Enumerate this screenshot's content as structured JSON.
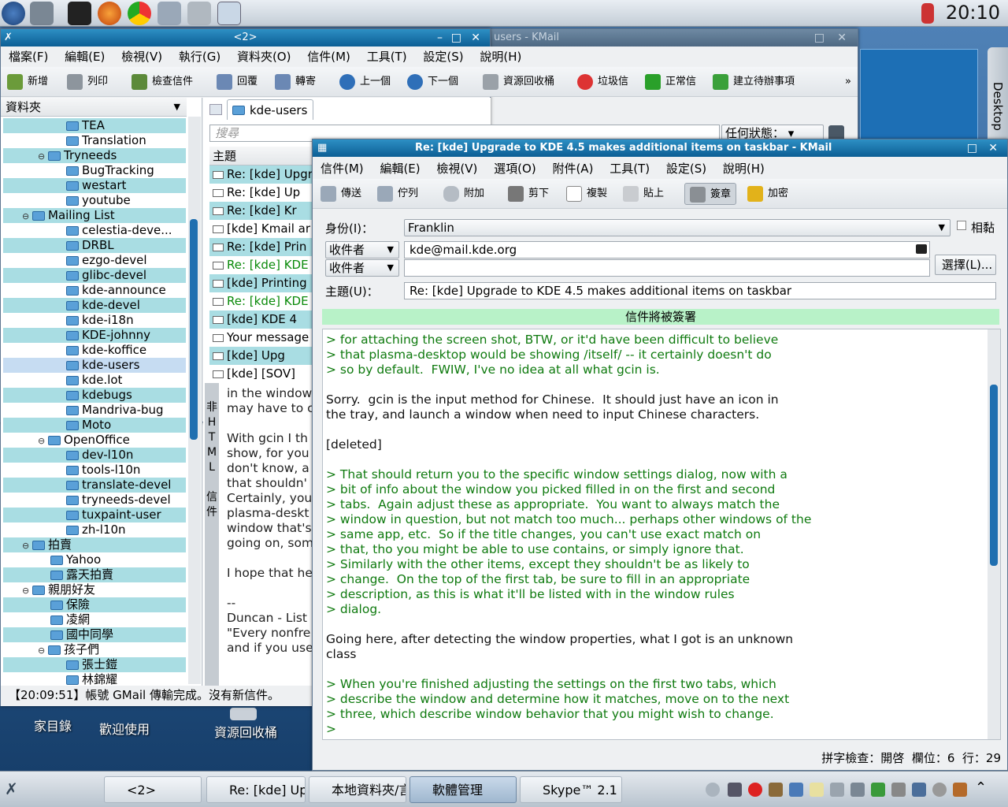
{
  "panel": {
    "clock": "20:10"
  },
  "desktop": {
    "icons": [
      "家目錄",
      "歡迎使用",
      "資源回收桶"
    ],
    "widget_label": "Desktop"
  },
  "kmail": {
    "title": "<2>",
    "bg_title": "users - KMail",
    "menu": [
      "檔案(F)",
      "編輯(E)",
      "檢視(V)",
      "執行(G)",
      "資料夾(O)",
      "信件(M)",
      "工具(T)",
      "設定(S)",
      "說明(H)"
    ],
    "toolbar": [
      "新增",
      "列印",
      "檢查信件",
      "回覆",
      "轉寄",
      "上一個",
      "下一個",
      "資源回收桶",
      "垃圾信",
      "正常信",
      "建立待辦事項"
    ],
    "folder_header": "資料夾",
    "tab": "kde-users",
    "search_placeholder": "搜尋",
    "status_filter": "任何狀態：",
    "list_header": "主題",
    "status": "【20:09:51】帳號 GMail 傳輸完成。沒有新信件。",
    "folders": [
      "TEA",
      "Translation",
      "Tryneeds",
      "BugTracking",
      "westart",
      "youtube",
      "Mailing List",
      "celestia-deve...",
      "DRBL",
      "ezgo-devel",
      "glibc-devel",
      "kde-announce",
      "kde-devel",
      "kde-i18n",
      "KDE-johnny",
      "kde-koffice",
      "kde-users",
      "kde.lot",
      "kdebugs",
      "Mandriva-bug",
      "Moto",
      "OpenOffice",
      "dev-l10n",
      "tools-l10n",
      "translate-devel",
      "tryneeds-devel",
      "tuxpaint-user",
      "zh-l10n",
      "拍賣",
      "Yahoo",
      "露天拍賣",
      "親朋好友",
      "保險",
      "凌網",
      "國中同學",
      "孩子們",
      "張士鎧",
      "林錦耀"
    ],
    "messages": [
      "Re: [kde] Upgr",
      "Re: [kde] Up",
      "Re: [kde] Kr",
      "[kde] Kmail ar",
      "Re: [kde] Prin",
      "Re: [kde] KDE",
      "[kde] Printing",
      "Re: [kde] KDE",
      "[kde] KDE 4",
      "Your message",
      "[kde] Upg",
      "[kde] [SOV]"
    ],
    "preview_side": [
      "非",
      "H",
      "T",
      "M",
      "L",
      "信",
      "件"
    ],
    "preview_lines": [
      "in the window",
      "may have to c",
      "",
      "With gcin I th",
      "show, for you",
      "don't know, a",
      "that shouldn'",
      "Certainly, you",
      "plasma-deskt",
      "window that's",
      "going on, som",
      "",
      "I hope that he",
      "",
      "--",
      "Duncan - List",
      "\"Every nonfre",
      "and if you use"
    ]
  },
  "composer": {
    "title": "Re: [kde] Upgrade to KDE 4.5 makes additional items on taskbar - KMail",
    "menu": [
      "信件(M)",
      "編輯(E)",
      "檢視(V)",
      "選項(O)",
      "附件(A)",
      "工具(T)",
      "設定(S)",
      "說明(H)"
    ],
    "toolbar": [
      "傳送",
      "佇列",
      "附加",
      "剪下",
      "複製",
      "貼上",
      "簽章",
      "加密"
    ],
    "identity_label": "身份(I)：",
    "identity": "Franklin",
    "sticky": "相黏",
    "to_label": "收件者",
    "to_value": "kde@mail.kde.org",
    "to2_label": "收件者",
    "choose": "選擇(L)...",
    "subject_label": "主題(U)：",
    "subject": "Re: [kde] Upgrade to KDE 4.5 makes additional items on taskbar",
    "sign_banner": "信件將被簽署",
    "body": [
      {
        "q": true,
        "t": "> for attaching the screen shot, BTW, or it'd have been difficult to believe"
      },
      {
        "q": true,
        "t": "> that plasma-desktop would be showing /itself/ -- it certainly doesn't do"
      },
      {
        "q": true,
        "t": "> so by default.  FWIW, I've no idea at all what gcin is."
      },
      {
        "q": false,
        "t": ""
      },
      {
        "q": false,
        "t": "Sorry.  gcin is the input method for Chinese.  It should just have an icon in"
      },
      {
        "q": false,
        "t": "the tray, and launch a window when need to input Chinese characters."
      },
      {
        "q": false,
        "t": ""
      },
      {
        "q": false,
        "t": "[deleted]"
      },
      {
        "q": false,
        "t": ""
      },
      {
        "q": true,
        "t": "> That should return you to the specific window settings dialog, now with a"
      },
      {
        "q": true,
        "t": "> bit of info about the window you picked filled in on the first and second"
      },
      {
        "q": true,
        "t": "> tabs.  Again adjust these as appropriate.  You want to always match the"
      },
      {
        "q": true,
        "t": "> window in question, but not match too much... perhaps other windows of the"
      },
      {
        "q": true,
        "t": "> same app, etc.  So if the title changes, you can't use exact match on"
      },
      {
        "q": true,
        "t": "> that, tho you might be able to use contains, or simply ignore that."
      },
      {
        "q": true,
        "t": "> Similarly with the other items, except they shouldn't be as likely to"
      },
      {
        "q": true,
        "t": "> change.  On the top of the first tab, be sure to fill in an appropriate"
      },
      {
        "q": true,
        "t": "> description, as this is what it'll be listed with in the window rules"
      },
      {
        "q": true,
        "t": "> dialog."
      },
      {
        "q": false,
        "t": ""
      },
      {
        "q": false,
        "t": "Going here, after detecting the window properties, what I got is an unknown"
      },
      {
        "q": false,
        "t": "class"
      },
      {
        "q": false,
        "t": ""
      },
      {
        "q": true,
        "t": "> When you're finished adjusting the settings on the first two tabs, which"
      },
      {
        "q": true,
        "t": "> describe the window and determine how it matches, move on to the next"
      },
      {
        "q": true,
        "t": "> three, which describe window behavior that you might wish to change."
      },
      {
        "q": true,
        "t": ">"
      }
    ],
    "status": "拼字檢查：開啓  欄位：6  行：29"
  },
  "taskbar": {
    "tasks": [
      "<2>",
      "Re: [kde] Up",
      "本地資料夾/言",
      "軟體管理",
      "Skype™ 2.1 ("
    ]
  }
}
